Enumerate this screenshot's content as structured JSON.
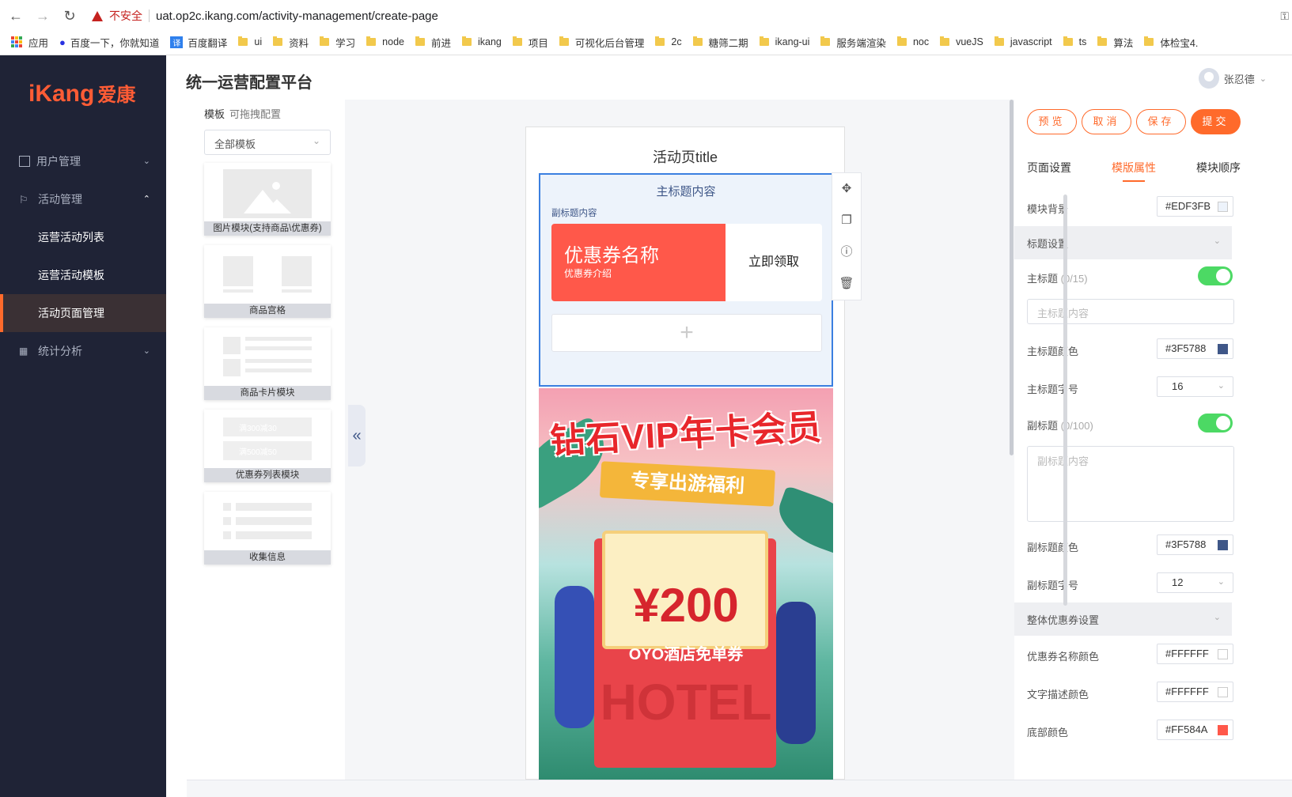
{
  "browser": {
    "security": "不安全",
    "url": "uat.op2c.ikang.com/activity-management/create-page",
    "bookmarks": [
      "应用",
      "百度一下，你就知道",
      "百度翻译",
      "ui",
      "资料",
      "学习",
      "node",
      "前进",
      "ikang",
      "项目",
      "可视化后台管理",
      "2c",
      "糖筛二期",
      "ikang-ui",
      "服务端渲染",
      "noc",
      "vueJS",
      "javascript",
      "ts",
      "算法",
      "体检宝4."
    ]
  },
  "app": {
    "logo_text": "iKang",
    "logo_cn": "爱康",
    "title": "统一运营配置平台",
    "user": "张忍德"
  },
  "sidebar": {
    "items": [
      {
        "label": "用户管理",
        "icon": "square-icon"
      },
      {
        "label": "活动管理",
        "icon": "flag-icon"
      },
      {
        "label": "运营活动列表"
      },
      {
        "label": "运营活动模板"
      },
      {
        "label": "活动页面管理"
      },
      {
        "label": "统计分析",
        "icon": "chart-icon"
      }
    ]
  },
  "templates": {
    "title": "模板",
    "hint": "可拖拽配置",
    "filter": "全部模板",
    "items": [
      {
        "caption": "图片模块(支持商品\\优惠券)"
      },
      {
        "caption": "商品宫格"
      },
      {
        "caption": "商品卡片模块"
      },
      {
        "caption": "优惠券列表模块",
        "lines": [
          "满300减30",
          "满500减50"
        ]
      },
      {
        "caption": "收集信息"
      }
    ]
  },
  "preview": {
    "page_title": "活动页title",
    "main_title": "主标题内容",
    "sub_title": "副标题内容",
    "coupon_name": "优惠券名称",
    "coupon_desc": "优惠券介绍",
    "coupon_btn": "立即领取",
    "add": "+",
    "banner": {
      "title": "钻石VIP年卡会员",
      "ribbon": "专享出游福利",
      "price": "¥200",
      "oyo": "OYO酒店免单券",
      "hotel": "HOTEL"
    }
  },
  "right": {
    "actions": [
      "预览",
      "取消",
      "保存",
      "提交"
    ],
    "tabs": [
      "页面设置",
      "模版属性",
      "模块顺序"
    ],
    "module_bg_label": "模块背景",
    "module_bg": "#EDF3FB",
    "title_section": "标题设置",
    "main_title_label": "主标题",
    "main_title_hint": "(0/15)",
    "main_title_placeholder": "主标题内容",
    "main_title_color_label": "主标题颜色",
    "main_title_color": "#3F5788",
    "main_title_size_label": "主标题字号",
    "main_title_size": "16",
    "sub_title_label": "副标题",
    "sub_title_hint": "(0/100)",
    "sub_title_placeholder": "副标题内容",
    "sub_title_color_label": "副标题颜色",
    "sub_title_color": "#3F5788",
    "sub_title_size_label": "副标题字号",
    "sub_title_size": "12",
    "coupon_section": "整体优惠券设置",
    "coupon_name_color_label": "优惠券名称颜色",
    "coupon_name_color": "#FFFFFF",
    "text_desc_color_label": "文字描述颜色",
    "text_desc_color": "#FFFFFF",
    "bottom_color_label": "底部颜色",
    "bottom_color": "#FF584A"
  }
}
